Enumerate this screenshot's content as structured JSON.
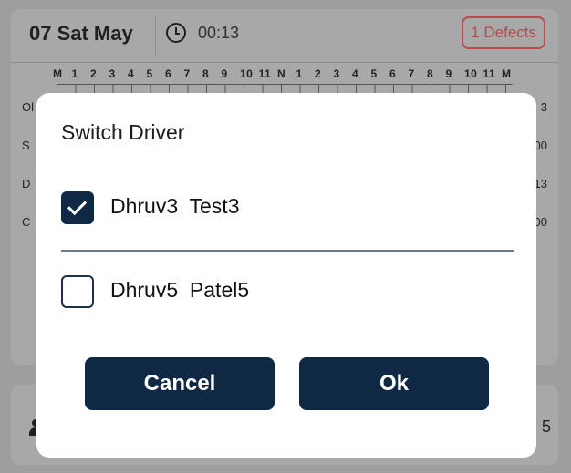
{
  "background": {
    "date": "07 Sat May",
    "time": "00:13",
    "defects_label": "1 Defects",
    "hour_labels": [
      "M",
      "1",
      "2",
      "3",
      "4",
      "5",
      "6",
      "7",
      "8",
      "9",
      "10",
      "11",
      "N",
      "1",
      "2",
      "3",
      "4",
      "5",
      "6",
      "7",
      "8",
      "9",
      "10",
      "11",
      "M"
    ],
    "left_labels": [
      "Ol",
      "S",
      "D",
      "C"
    ],
    "right_labels": [
      "3",
      "00",
      "13",
      "00"
    ],
    "bottom_right": "5"
  },
  "dialog": {
    "title": "Switch Driver",
    "options": [
      {
        "label": "Dhruv3  Test3",
        "checked": true
      },
      {
        "label": "Dhruv5  Patel5",
        "checked": false
      }
    ],
    "cancel_label": "Cancel",
    "ok_label": "Ok"
  },
  "colors": {
    "primary": "#0f2944",
    "overlay": "#9e9e9e",
    "defect": "#b34c4c"
  }
}
